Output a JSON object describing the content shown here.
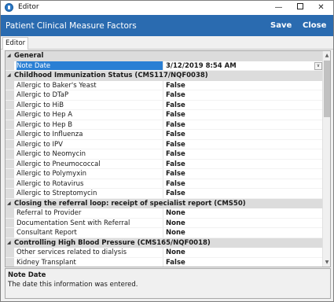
{
  "window": {
    "title": "Editor"
  },
  "header": {
    "title": "Patient Clinical Measure Factors",
    "save_label": "Save",
    "close_label": "Close"
  },
  "tabs": [
    {
      "label": "Editor"
    }
  ],
  "grid": {
    "rows": [
      {
        "kind": "cat",
        "label": "General"
      },
      {
        "kind": "prop",
        "name": "Note Date",
        "value": "3/12/2019 8:54 AM",
        "selected": true,
        "dropdown": true
      },
      {
        "kind": "cat",
        "label": "Childhood Immunization Status (CMS117/NQF0038)"
      },
      {
        "kind": "prop",
        "name": "Allergic to Baker's Yeast",
        "value": "False"
      },
      {
        "kind": "prop",
        "name": "Allergic to DTaP",
        "value": "False"
      },
      {
        "kind": "prop",
        "name": "Allergic to HiB",
        "value": "False"
      },
      {
        "kind": "prop",
        "name": "Allergic to Hep A",
        "value": "False"
      },
      {
        "kind": "prop",
        "name": "Allergic to Hep B",
        "value": "False"
      },
      {
        "kind": "prop",
        "name": "Allergic to Influenza",
        "value": "False"
      },
      {
        "kind": "prop",
        "name": "Allergic to IPV",
        "value": "False"
      },
      {
        "kind": "prop",
        "name": "Allergic to Neomycin",
        "value": "False"
      },
      {
        "kind": "prop",
        "name": "Allergic to Pneumococcal",
        "value": "False"
      },
      {
        "kind": "prop",
        "name": "Allergic to Polymyxin",
        "value": "False"
      },
      {
        "kind": "prop",
        "name": "Allergic to Rotavirus",
        "value": "False"
      },
      {
        "kind": "prop",
        "name": "Allergic to Streptomycin",
        "value": "False"
      },
      {
        "kind": "cat",
        "label": "Closing the referral loop: receipt of specialist report (CMS50)"
      },
      {
        "kind": "prop",
        "name": "Referral to Provider",
        "value": "None"
      },
      {
        "kind": "prop",
        "name": "Documentation Sent with Referral",
        "value": "None"
      },
      {
        "kind": "prop",
        "name": "Consultant Report",
        "value": "None"
      },
      {
        "kind": "cat",
        "label": "Controlling High Blood Pressure (CMS165/NQF0018)"
      },
      {
        "kind": "prop",
        "name": "Other services related to dialysis",
        "value": "None"
      },
      {
        "kind": "prop",
        "name": "Kidney Transplant",
        "value": "False"
      }
    ]
  },
  "description": {
    "title": "Note Date",
    "text": "The date this information was entered."
  },
  "icons": {
    "collapse": "triangle-down-icon",
    "dropdown": "chevron-down-icon"
  }
}
